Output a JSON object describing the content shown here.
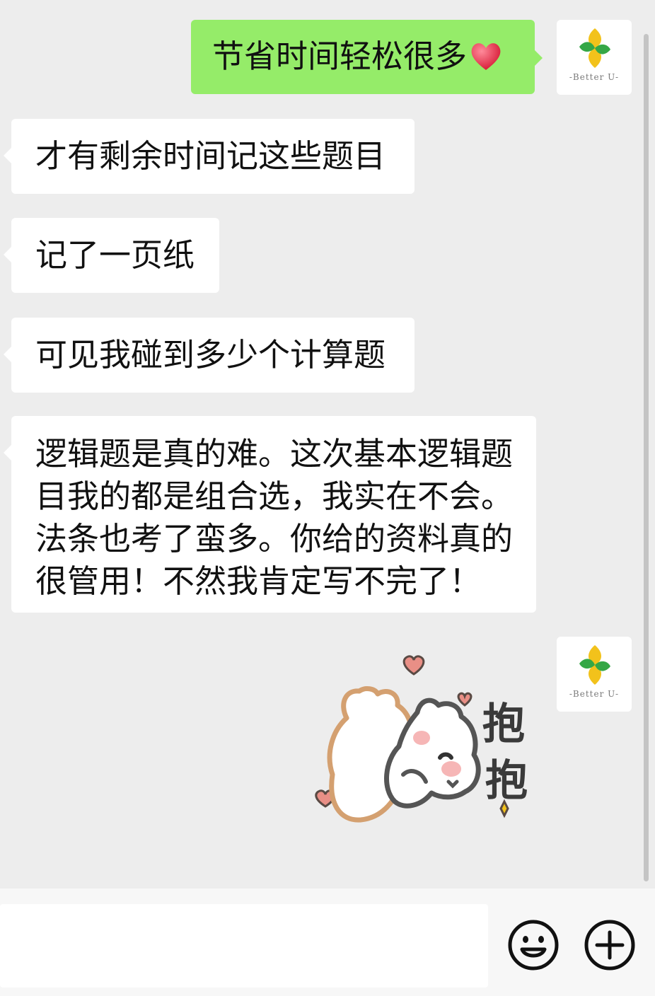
{
  "contact_avatar": {
    "brand_text": "-Better U-"
  },
  "messages": [
    {
      "from": "self",
      "lines": [
        "节省时间轻松很多"
      ],
      "trailing_emoji": "heart"
    },
    {
      "from": "other",
      "lines": [
        "才有剩余时间记这些题目"
      ]
    },
    {
      "from": "other",
      "lines": [
        "记了一页纸"
      ]
    },
    {
      "from": "other",
      "lines": [
        "可见我碰到多少个计算题"
      ]
    },
    {
      "from": "other",
      "lines": [
        "逻辑题是真的难。这次基本逻辑题",
        "目我的都是组合选，我实在不会。",
        "法条也考了蛮多。你给的资料真的",
        "很管用！不然我肯定写不完了！"
      ]
    }
  ],
  "sticker": {
    "char1": "抱",
    "char2": "抱"
  },
  "input_bar": {
    "placeholder": "",
    "value": ""
  },
  "colors": {
    "background": "#ededed",
    "outgoing_bubble": "#95ec69",
    "incoming_bubble": "#ffffff",
    "heart": "#e8334a"
  },
  "icons": [
    "emoji-icon",
    "plus-icon",
    "heart-icon",
    "logo-icon"
  ]
}
